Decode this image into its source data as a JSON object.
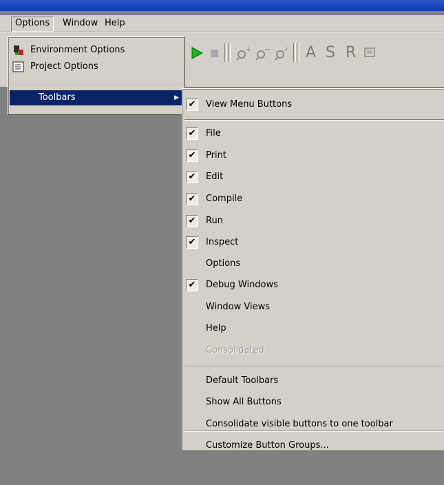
{
  "menubar": {
    "items": [
      "Options",
      "Window",
      "Help"
    ]
  },
  "options_menu": {
    "items": [
      {
        "label": "Environment Options",
        "icon": "environment-options-icon"
      },
      {
        "label": "Project Options",
        "icon": "project-options-icon"
      },
      {
        "label": "Toolbars",
        "submenu": true,
        "highlighted": true
      }
    ]
  },
  "toolbar": {
    "letters": [
      "A",
      "S",
      "R"
    ]
  },
  "toolbars_submenu": {
    "items": [
      {
        "label": "View Menu Buttons",
        "checked": true
      },
      {
        "label": "File",
        "checked": true
      },
      {
        "label": "Print",
        "checked": true
      },
      {
        "label": "Edit",
        "checked": true
      },
      {
        "label": "Compile",
        "checked": true
      },
      {
        "label": "Run",
        "checked": true
      },
      {
        "label": "Inspect",
        "checked": true
      },
      {
        "label": "Options",
        "checked": false
      },
      {
        "label": "Debug Windows",
        "checked": true
      },
      {
        "label": "Window Views",
        "checked": false
      },
      {
        "label": "Help",
        "checked": false
      },
      {
        "label": "Consolidated",
        "checked": false,
        "disabled": true
      },
      {
        "label": "Default Toolbars",
        "checked": false
      },
      {
        "label": "Show All Buttons",
        "checked": false
      },
      {
        "label": "Consolidate visible buttons to one toolbar",
        "checked": false
      },
      {
        "label": "Customize Button Groups...",
        "checked": false
      }
    ],
    "check_glyph": "✔"
  },
  "colors": {
    "highlight": "#0a246a",
    "menu_face": "#d4d0c8",
    "desktop": "#808080"
  }
}
